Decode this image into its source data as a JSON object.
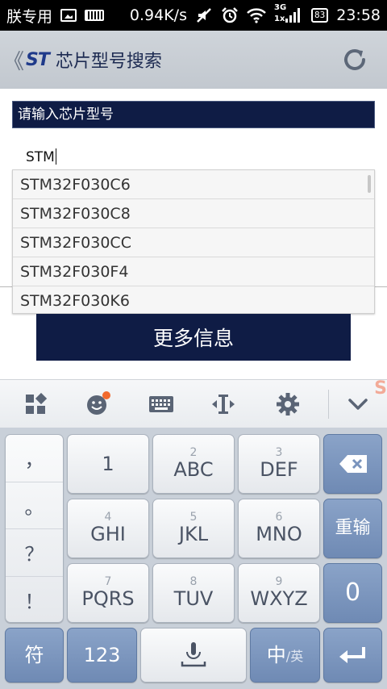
{
  "status_bar": {
    "carrier": "朕专用",
    "speed": "0.94K/s",
    "network": "3G",
    "network_sub": "1x",
    "battery": "83",
    "time": "23:58"
  },
  "header": {
    "back_glyph": "《",
    "logo": "ST",
    "title": "芯片型号搜索"
  },
  "search": {
    "label": "请输入芯片型号",
    "value": "STM"
  },
  "suggestions": [
    "STM32F030C6",
    "STM32F030C8",
    "STM32F030CC",
    "STM32F030F4",
    "STM32F030K6"
  ],
  "more_button": {
    "label": "更多信息"
  },
  "ime_toolbar": {
    "items": [
      "apps-icon",
      "emoji-icon",
      "keyboard-icon",
      "cursor-move-icon",
      "settings-icon",
      "collapse-icon"
    ]
  },
  "keyboard": {
    "punctuation": [
      "，",
      "。",
      "？",
      "！"
    ],
    "keys": [
      {
        "main": "1",
        "sub": ""
      },
      {
        "main": "ABC",
        "sub": "2"
      },
      {
        "main": "DEF",
        "sub": "3"
      },
      {
        "main": "GHI",
        "sub": "4"
      },
      {
        "main": "JKL",
        "sub": "5"
      },
      {
        "main": "MNO",
        "sub": "6"
      },
      {
        "main": "PQRS",
        "sub": "7"
      },
      {
        "main": "TUV",
        "sub": "8"
      },
      {
        "main": "WXYZ",
        "sub": "9"
      }
    ],
    "reinput": "重输",
    "zero": "0",
    "symbol": "符",
    "num": "123",
    "lang_main": "中",
    "lang_sub": "/英"
  },
  "colors": {
    "accent_navy": "#0f1c45",
    "header_bg": "#c9ced5",
    "keyboard_bg": "#c9d0d9",
    "key_blue": "#7a94bd"
  }
}
